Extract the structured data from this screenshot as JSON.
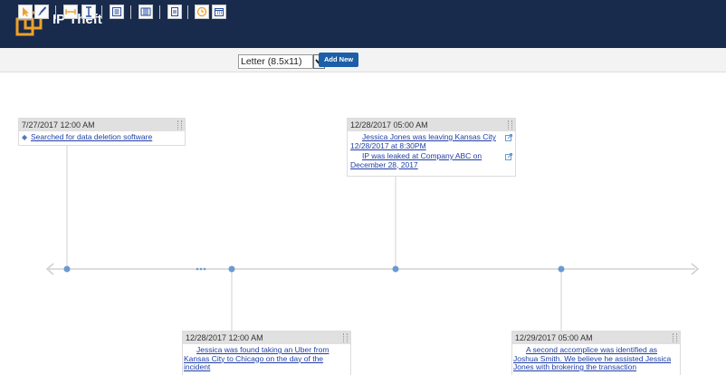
{
  "app": {
    "title": "IP Theft"
  },
  "toolbar": {
    "page_size": "Letter (8.5x11)",
    "add_new_label": "Add New"
  },
  "events": [
    {
      "date": "7/27/2017 12:00 AM",
      "entries": [
        "Searched for data deletion software"
      ]
    },
    {
      "date": "12/28/2017 05:00 AM",
      "entries": [
        "Jessica Jones was leaving Kansas City 12/28/2017 at 8:30PM",
        "IP was leaked at Company ABC on December 28, 2017"
      ]
    },
    {
      "date": "12/28/2017 12:00 AM",
      "entries": [
        "Jessica was found taking an Uber from Kansas City to Chicago on the day of the incident"
      ]
    },
    {
      "date": "12/29/2017 05:00 AM",
      "entries": [
        "A second accomplice was identified as Joshua Smith. We believe he assisted Jessica Jones with brokering the transaction"
      ]
    }
  ],
  "colors": {
    "header_bg": "#182b4c",
    "accent": "#f0a12a",
    "timeline_dot": "#6b9ad1",
    "link": "#1f3fa6"
  }
}
